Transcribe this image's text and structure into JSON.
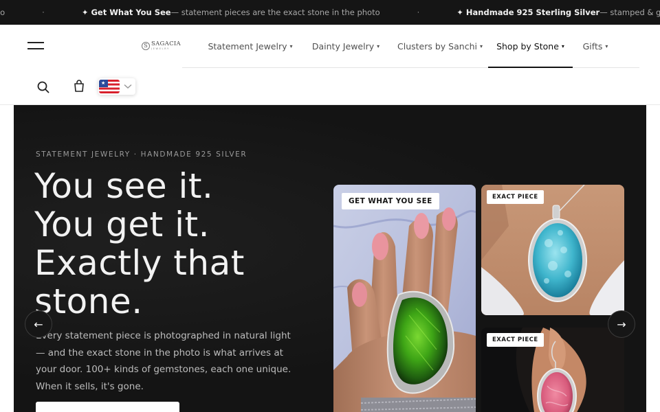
{
  "announcement": {
    "lead_fragment": "photo",
    "separator": "·",
    "items": [
      {
        "highlight": "✦ Get What You See",
        "text": " — statement pieces are the exact stone in the photo"
      },
      {
        "highlight": "✦ Handmade 925 Sterling Silver",
        "text": " — stamped & g"
      }
    ]
  },
  "header": {
    "logo": {
      "seal": "S",
      "name": "SAGACIA",
      "tagline": "JEWELRY"
    },
    "nav": [
      {
        "label": "Statement Jewelry",
        "caret": "▾",
        "active": false
      },
      {
        "label": "Dainty Jewelry",
        "caret": "▾",
        "active": false
      },
      {
        "label": "Clusters by Sanchi",
        "caret": "▾",
        "active": false
      },
      {
        "label": "Shop by Stone",
        "caret": "▾",
        "active": true
      },
      {
        "label": "Gifts",
        "caret": "▾",
        "active": false
      }
    ],
    "icons": [
      "menu-icon",
      "search-icon",
      "cart-icon",
      "us-flag-icon",
      "chevron-down-icon"
    ]
  },
  "hero": {
    "eyebrow": "STATEMENT JEWELRY · HANDMADE 925 SILVER",
    "headline": [
      "You see it.",
      "You get it.",
      "Exactly that",
      "stone."
    ],
    "body": "Every statement piece is photographed in natural light — and the exact stone in the photo is what arrives at your door. 100+ kinds of gemstones, each one unique. When it sells, it's gone.",
    "arrow_prev": "←",
    "arrow_next": "→",
    "cards": [
      {
        "badge": "GET WHAT YOU SEE",
        "subject": "ammolite ring on hand"
      },
      {
        "badge": "EXACT PIECE",
        "subject": "larimar pendant"
      },
      {
        "badge": "EXACT PIECE",
        "subject": "rhodochrosite earring"
      }
    ]
  },
  "colors": {
    "dark": "#151515",
    "text_light": "#f2f2f2",
    "muted": "#9a9a9a",
    "accent_active": "#111111"
  }
}
